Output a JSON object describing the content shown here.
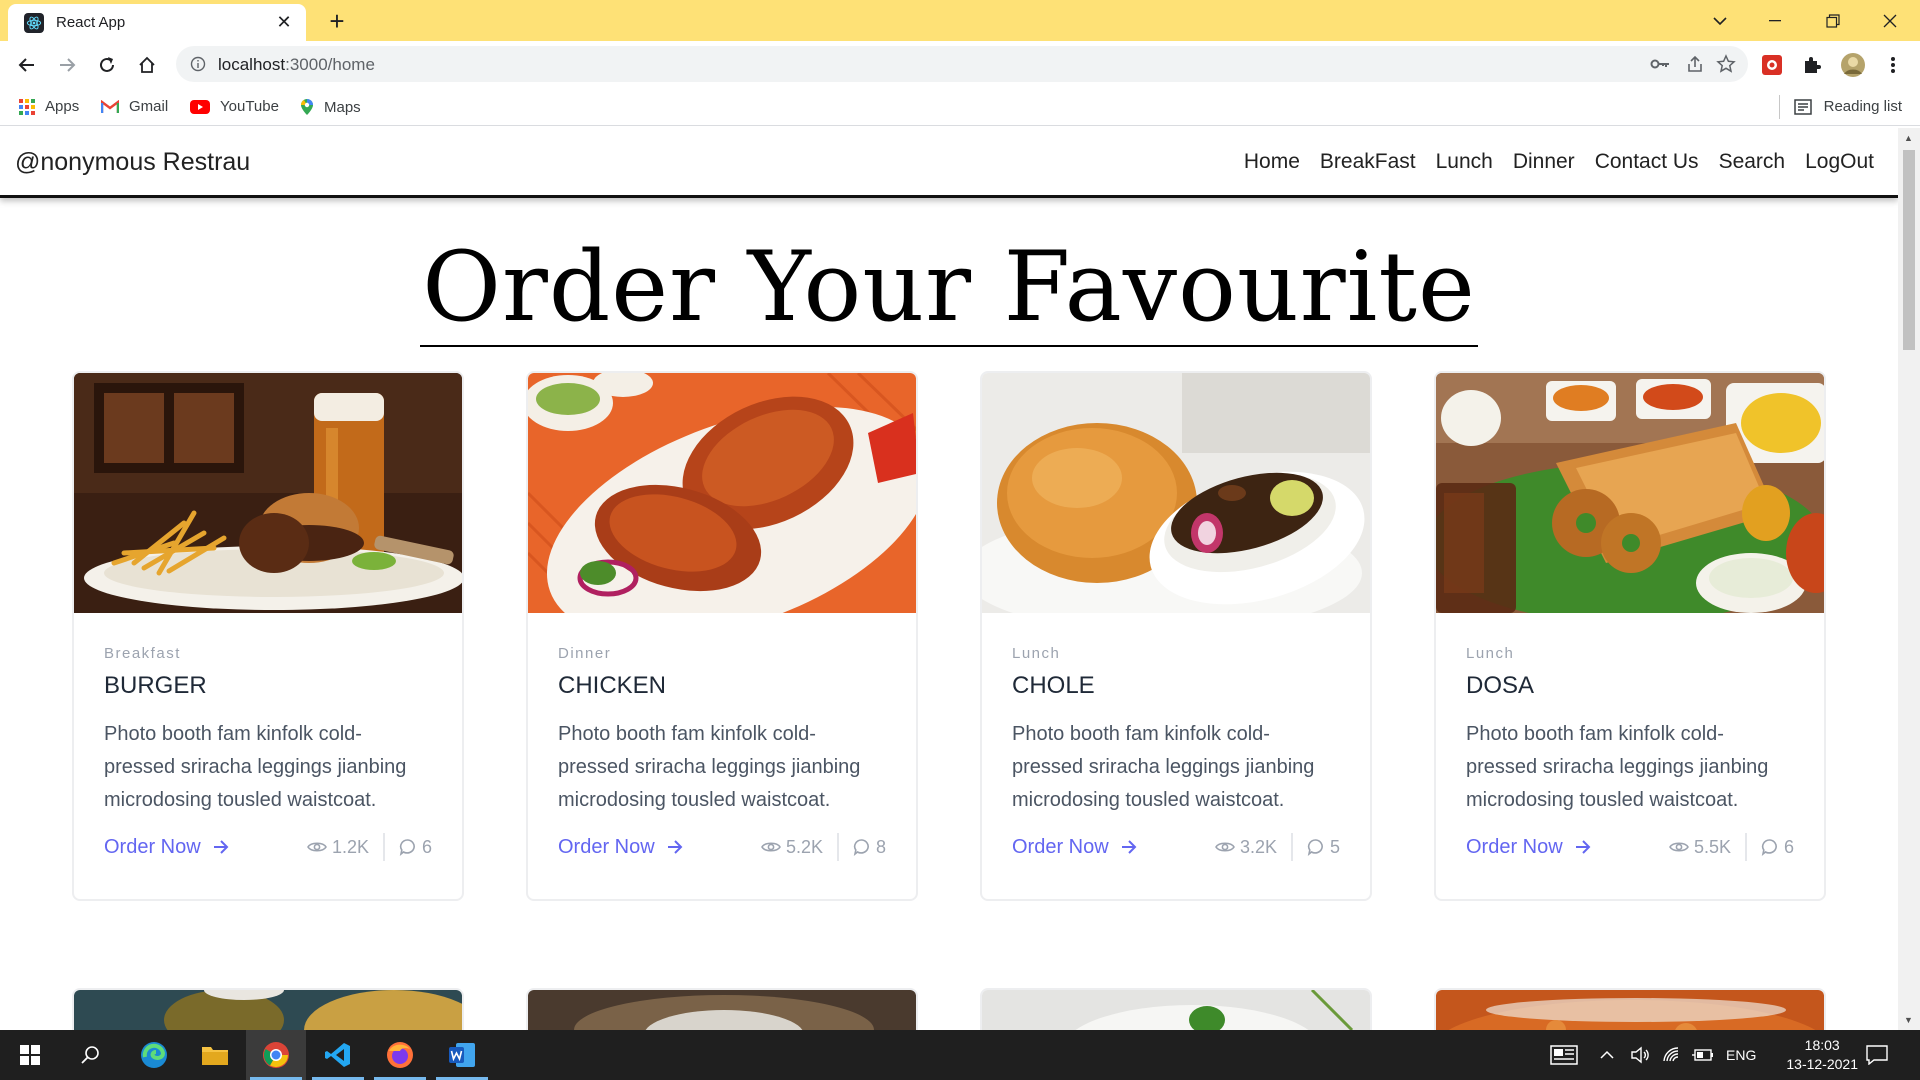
{
  "browser": {
    "tab_title": "React App",
    "url_host": "localhost",
    "url_path": ":3000/home",
    "bookmarks": [
      {
        "label": "Apps",
        "icon": "apps-grid-icon"
      },
      {
        "label": "Gmail",
        "icon": "gmail-icon"
      },
      {
        "label": "YouTube",
        "icon": "youtube-icon"
      },
      {
        "label": "Maps",
        "icon": "maps-icon"
      }
    ],
    "reading_list": "Reading list"
  },
  "site": {
    "brand": "@nonymous Restrau",
    "menu": [
      "Home",
      "BreakFast",
      "Lunch",
      "Dinner",
      "Contact Us",
      "Search",
      "LogOut"
    ],
    "heading": "Order Your Favourite"
  },
  "cards": [
    {
      "category": "Breakfast",
      "name": "BURGER",
      "description": "Photo booth fam kinfolk cold-pressed sriracha leggings jianbing microdosing tousled waistcoat.",
      "cta": "Order Now",
      "views": "1.2K",
      "comments": "6"
    },
    {
      "category": "Dinner",
      "name": "CHICKEN",
      "description": "Photo booth fam kinfolk cold-pressed sriracha leggings jianbing microdosing tousled waistcoat.",
      "cta": "Order Now",
      "views": "5.2K",
      "comments": "8"
    },
    {
      "category": "Lunch",
      "name": "CHOLE",
      "description": "Photo booth fam kinfolk cold-pressed sriracha leggings jianbing microdosing tousled waistcoat.",
      "cta": "Order Now",
      "views": "3.2K",
      "comments": "5"
    },
    {
      "category": "Lunch",
      "name": "DOSA",
      "description": "Photo booth fam kinfolk cold-pressed sriracha leggings jianbing microdosing tousled waistcoat.",
      "cta": "Order Now",
      "views": "5.5K",
      "comments": "6"
    }
  ],
  "taskbar": {
    "language": "ENG",
    "time": "18:03",
    "date": "13-12-2021"
  },
  "colors": {
    "tabbar": "#fee176",
    "accent": "#6366f1",
    "taskbar": "#1f1f1f"
  }
}
